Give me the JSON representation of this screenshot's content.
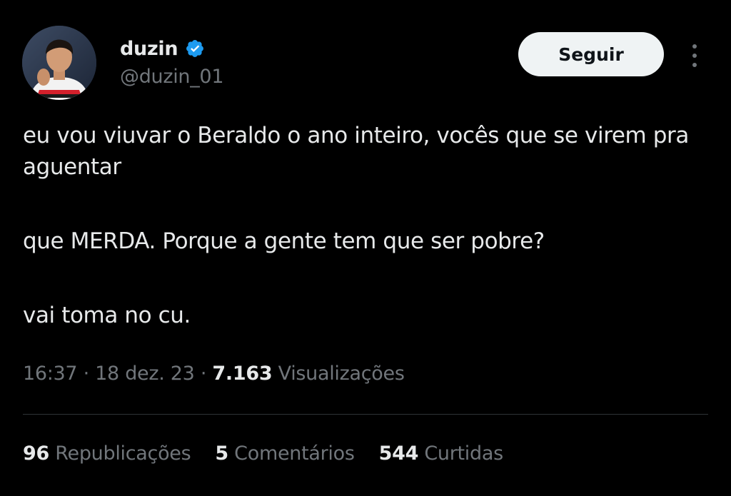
{
  "author": {
    "display_name": "duzin",
    "handle": "@duzin_01",
    "verified": true
  },
  "follow_button": {
    "label": "Seguir"
  },
  "tweet": {
    "paragraphs": [
      "eu vou viuvar o Beraldo o ano inteiro, vocês que se virem pra aguentar",
      "que MERDA. Porque a gente tem que ser pobre?",
      "vai toma no cu."
    ]
  },
  "meta": {
    "time": "16:37",
    "separator": " · ",
    "date": "18 dez. 23",
    "views_count": "7.163",
    "views_label": "Visualizações"
  },
  "stats": {
    "reposts": {
      "count": "96",
      "label": "Republicações"
    },
    "comments": {
      "count": "5",
      "label": "Comentários"
    },
    "likes": {
      "count": "544",
      "label": "Curtidas"
    }
  },
  "colors": {
    "background": "#000000",
    "primary_text": "#e7e9ea",
    "secondary_text": "#71767b",
    "verified_badge": "#1d9bf0",
    "follow_button_bg": "#eff3f4"
  },
  "icons": {
    "verified": "verified-badge-icon",
    "more": "more-options-icon"
  }
}
